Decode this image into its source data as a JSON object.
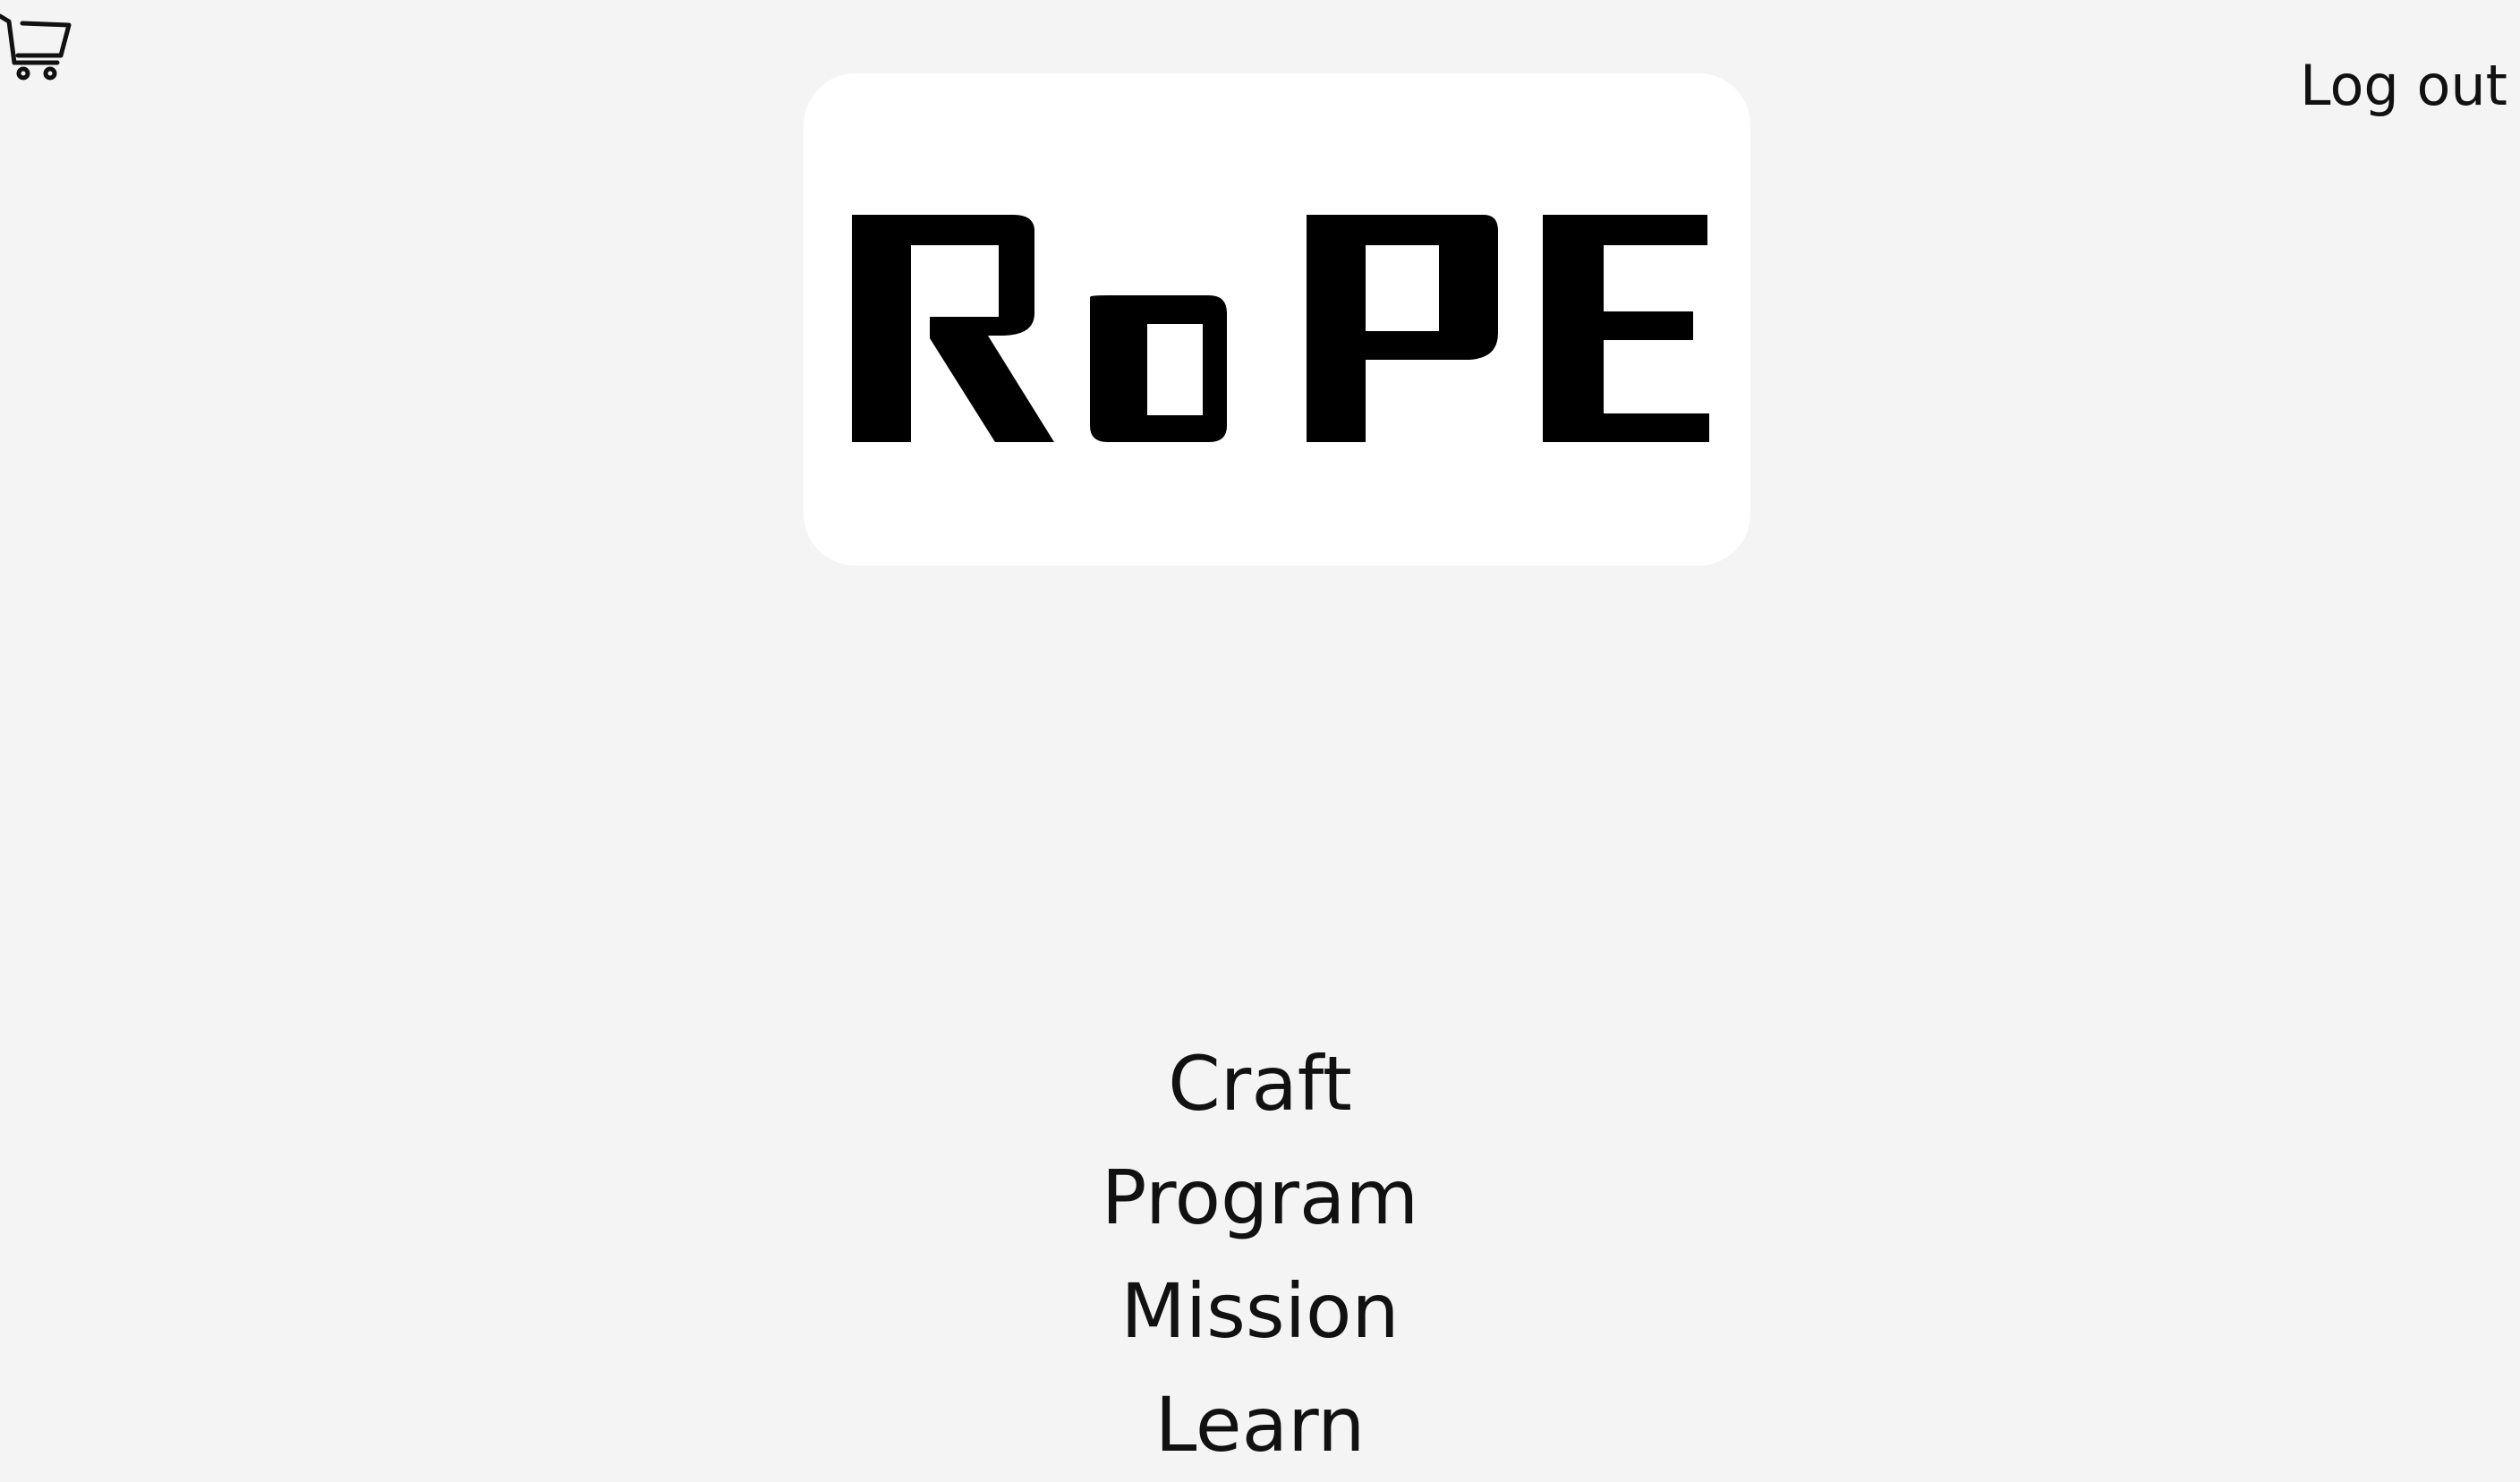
{
  "header": {
    "cart_icon": "shopping-cart-icon",
    "logout_label": "Log out"
  },
  "logo": {
    "text": "RoPE",
    "card_color": "#ffffff",
    "ink_color": "#000000"
  },
  "nav": {
    "items": [
      {
        "label": "Craft"
      },
      {
        "label": "Program"
      },
      {
        "label": "Mission"
      },
      {
        "label": "Learn"
      }
    ]
  },
  "colors": {
    "background": "#f4f4f4",
    "text": "#111111"
  }
}
